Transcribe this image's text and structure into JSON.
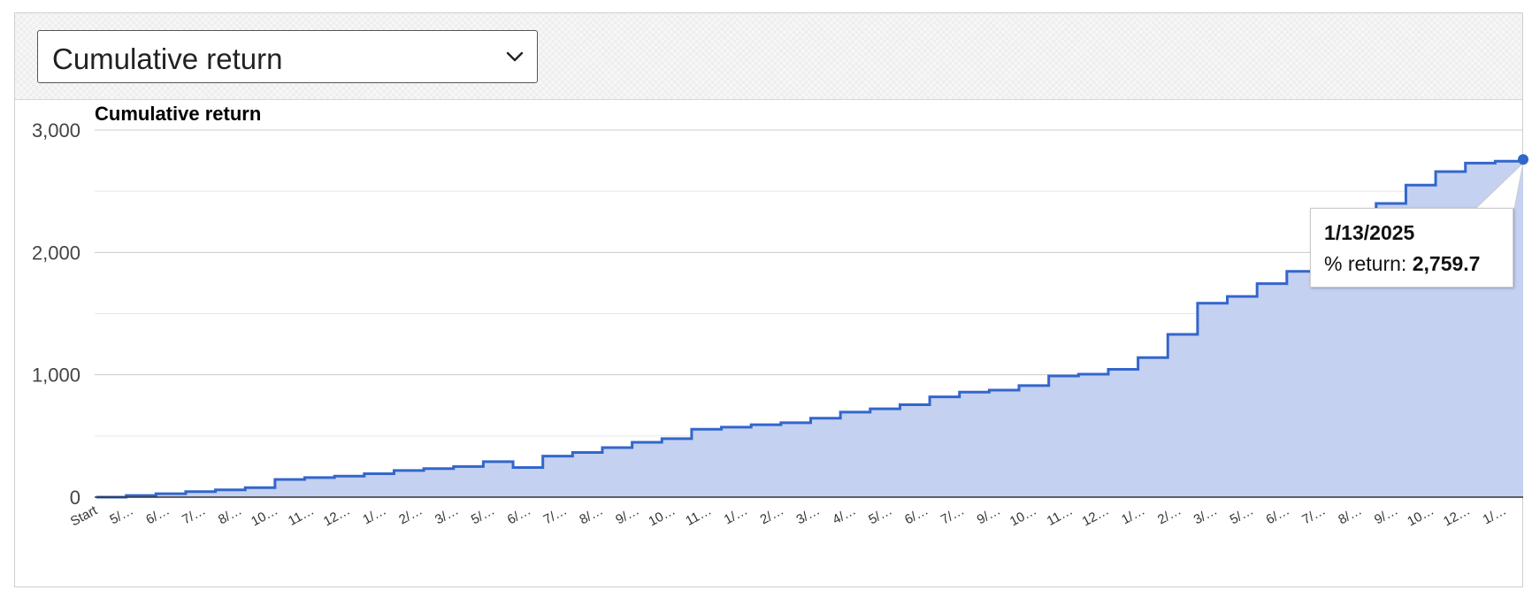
{
  "selector": {
    "selected": "Cumulative return"
  },
  "colors": {
    "line": "#3366cc",
    "area": "#c5d1f0",
    "grid": "#cccccc"
  },
  "icons": {
    "dropdown": "chevron-down-icon"
  },
  "tooltip": {
    "date": "1/13/2025",
    "label": "% return:",
    "value": "2,759.7"
  },
  "chart_data": {
    "type": "area",
    "title": "Cumulative return",
    "xlabel": "",
    "ylabel": "",
    "ylim": [
      0,
      3000
    ],
    "yticks": [
      "0",
      "1,000",
      "2,000",
      "3,000"
    ],
    "grid": true,
    "legend": "none",
    "x_tick_labels": [
      "Start",
      "5/…",
      "6/…",
      "7/…",
      "8/…",
      "10…",
      "11…",
      "12…",
      "1/…",
      "2/…",
      "3/…",
      "5/…",
      "6/…",
      "7/…",
      "8/…",
      "9/…",
      "10…",
      "11…",
      "1/…",
      "2/…",
      "3/…",
      "4/…",
      "5/…",
      "6/…",
      "7/…",
      "9/…",
      "10…",
      "11…",
      "12…",
      "1/…",
      "2/…",
      "3/…",
      "5/…",
      "6/…",
      "7/…",
      "8/…",
      "9/…",
      "10…",
      "12…",
      "1/…"
    ],
    "series": [
      {
        "values": [
          0,
          14,
          28,
          45,
          60,
          78,
          145,
          160,
          172,
          192,
          218,
          233,
          250,
          290,
          242,
          335,
          365,
          405,
          448,
          478,
          555,
          572,
          592,
          608,
          645,
          695,
          722,
          755,
          820,
          858,
          875,
          912,
          990,
          1005,
          1045,
          1140,
          1330,
          1585,
          1640,
          1745,
          1845,
          2000,
          2230,
          2400,
          2550,
          2660,
          2730,
          2745,
          2759.7
        ]
      }
    ],
    "highlight": {
      "date": "1/13/2025",
      "value": 2759.7
    }
  }
}
